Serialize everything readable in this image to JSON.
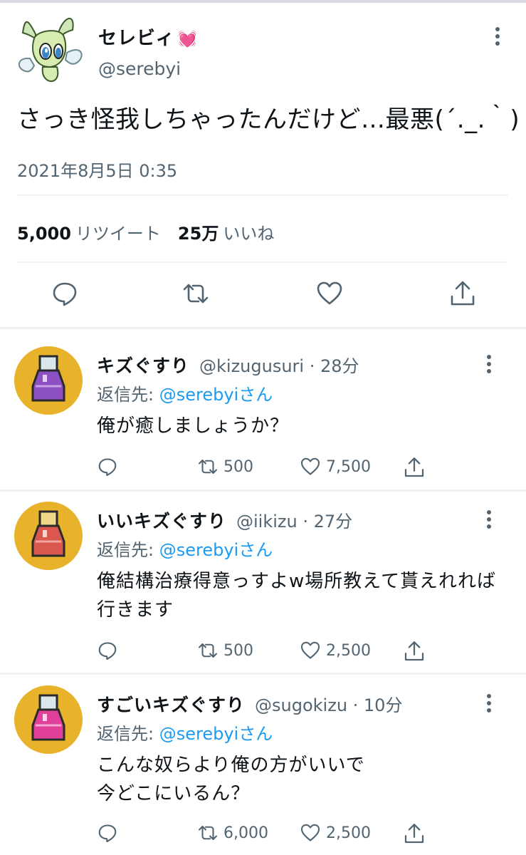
{
  "main_tweet": {
    "display_name": "セレビィ",
    "name_emoji": "💓",
    "handle": "@serebyi",
    "text": "さっき怪我しちゃったんだけど…最悪(´._.｀)",
    "timestamp": "2021年8月5日 0:35",
    "retweet_count": "5,000",
    "retweet_label": "リツイート",
    "like_count": "25万",
    "like_label": "いいね",
    "avatar_icon": "celebi-avatar"
  },
  "replies": [
    {
      "display_name": "キズぐすり",
      "meta": "@kizugusuri · 28分",
      "reply_to_prefix": "返信先: ",
      "reply_to_handle": "@serebyiさん",
      "text": "俺が癒しましょうか？",
      "retweets": "500",
      "likes": "7,500",
      "avatar_icon": "potion-avatar",
      "potion_color": "#7a3fb0"
    },
    {
      "display_name": "いいキズぐすり",
      "meta": "@iikizu · 27分",
      "reply_to_prefix": "返信先: ",
      "reply_to_handle": "@serebyiさん",
      "text": "俺結構治療得意っすよw場所教えて貰えれれば\n行きます",
      "retweets": "500",
      "likes": "2,500",
      "avatar_icon": "super-potion-avatar",
      "potion_color": "#d9574f"
    },
    {
      "display_name": "すごいキズぐすり",
      "meta": "@sugokizu · 10分",
      "reply_to_prefix": "返信先: ",
      "reply_to_handle": "@serebyiさん",
      "text": "こんな奴らより俺の方がいいで\n今どこにいるん？",
      "retweets": "6,000",
      "likes": "2,500",
      "avatar_icon": "hyper-potion-avatar",
      "potion_color": "#e0409a"
    }
  ],
  "colors": {
    "link": "#1d9bf0",
    "secondary_text": "#536471",
    "avatar_bg": "#e8b32a"
  }
}
